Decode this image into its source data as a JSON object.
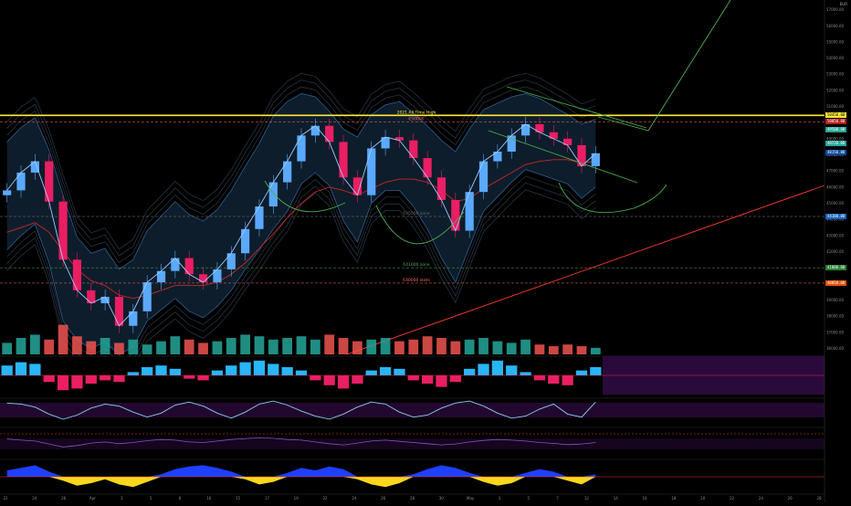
{
  "chart_data": {
    "type": "line",
    "title": "",
    "xlabel": "",
    "ylabel": "",
    "x_ticks": [
      "22",
      "24",
      "26",
      "Apr",
      "3",
      "5",
      "8",
      "10",
      "15",
      "17",
      "19",
      "22",
      "24",
      "26",
      "28",
      "30",
      "May",
      "3",
      "5",
      "7",
      "12",
      "14",
      "16",
      "18",
      "20",
      "22",
      "24",
      "26",
      "28"
    ],
    "y_ticks": [
      "57000.00",
      "56000.00",
      "55000.00",
      "54000.00",
      "53000.00",
      "52000.00",
      "51000.00",
      "50000.00",
      "49000.00",
      "48000.00",
      "47000.00",
      "46000.00",
      "45000.00",
      "44000.00",
      "43000.00",
      "42000.00",
      "41000.00",
      "40000.00",
      "39000.00",
      "38000.00",
      "37000.00",
      "36000.00"
    ],
    "ylim": [
      35800,
      57600
    ],
    "levels": [
      {
        "label": "2021 All Time High",
        "value": 50450,
        "color": "#ffeb3b"
      },
      {
        "label": "€50000",
        "value": 50050,
        "color": "#ff6b6b"
      },
      {
        "label": "€45000 zone",
        "value": 44180,
        "color": "#6a6a6a"
      },
      {
        "label": "€41000 zone",
        "value": 41000,
        "color": "#4caf50"
      },
      {
        "label": "€40000 stats",
        "value": 40050,
        "color": "#ff6b6b"
      }
    ],
    "price_labels": [
      {
        "text": "50450.00",
        "value": 50450,
        "bg": "#ffeb3b",
        "fg": "#000"
      },
      {
        "text": "50050.00",
        "value": 50050,
        "bg": "#b71c1c",
        "fg": "#fff"
      },
      {
        "text": "49500.00",
        "value": 49550,
        "bg": "#26a69a",
        "fg": "#fff"
      },
      {
        "text": "48720.00",
        "value": 48700,
        "bg": "#26a69a",
        "fg": "#fff"
      },
      {
        "text": "48150.00",
        "value": 48150,
        "bg": "#0d47a1",
        "fg": "#fff"
      },
      {
        "text": "44180.00",
        "value": 44180,
        "bg": "#1565c0",
        "fg": "#fff"
      },
      {
        "text": "41000.00",
        "value": 41000,
        "bg": "#2e7d32",
        "fg": "#fff"
      },
      {
        "text": "40050.00",
        "value": 40050,
        "bg": "#e65100",
        "fg": "#fff"
      }
    ],
    "series": [
      {
        "name": "",
        "color": "#5aa9ff",
        "values": [
          45800,
          46900,
          47600,
          45100,
          41500,
          39600,
          38800,
          39200,
          37400,
          38300,
          40100,
          40800,
          41600,
          40600,
          40100,
          40900,
          41900,
          43400,
          44800,
          46300,
          47600,
          49200,
          49800,
          48800,
          46600,
          45500,
          48400,
          49100,
          48900,
          47800,
          46600,
          45200,
          43300,
          45700,
          47600,
          48200,
          49200,
          49900,
          49400,
          49000,
          48600,
          47300,
          48100
        ]
      }
    ],
    "bb_upper": [
      48800,
      49700,
      50300,
      48300,
      45500,
      42900,
      41900,
      42200,
      40900,
      41500,
      43300,
      44200,
      45100,
      44300,
      43900,
      44600,
      45800,
      47300,
      48700,
      50400,
      51300,
      51800,
      51600,
      50700,
      49600,
      49100,
      50500,
      51100,
      51300,
      50600,
      49800,
      48900,
      48200,
      49600,
      50800,
      51200,
      51600,
      51800,
      51500,
      51000,
      50500,
      49900,
      50200
    ],
    "bb_lower": [
      42100,
      43000,
      43700,
      41300,
      37700,
      36500,
      36000,
      36400,
      35600,
      36100,
      37700,
      38400,
      39100,
      38300,
      37900,
      38600,
      39600,
      40900,
      42100,
      43400,
      44500,
      46200,
      46900,
      46100,
      43900,
      42600,
      45000,
      45800,
      45800,
      44800,
      43400,
      41600,
      40100,
      42300,
      44500,
      45400,
      46300,
      47100,
      46800,
      46500,
      46200,
      45300,
      46000
    ],
    "ema_red": [
      43200,
      43500,
      43800,
      43200,
      42000,
      40900,
      40200,
      39900,
      39300,
      39100,
      39300,
      39600,
      39900,
      39900,
      39900,
      40100,
      40600,
      41300,
      42200,
      43100,
      44100,
      45000,
      45700,
      46000,
      45800,
      45500,
      45900,
      46300,
      46500,
      46500,
      46300,
      45800,
      45100,
      45300,
      45900,
      46400,
      46900,
      47400,
      47600,
      47700,
      47700,
      47500,
      47600
    ],
    "volume": [
      0.35,
      0.5,
      0.6,
      0.45,
      0.9,
      0.55,
      0.4,
      0.5,
      0.35,
      0.45,
      0.3,
      0.4,
      0.55,
      0.45,
      0.35,
      0.4,
      0.5,
      0.6,
      0.55,
      0.45,
      0.5,
      0.55,
      0.45,
      0.6,
      0.5,
      0.4,
      0.45,
      0.5,
      0.4,
      0.45,
      0.55,
      0.5,
      0.4,
      0.45,
      0.5,
      0.4,
      0.35,
      0.45,
      0.3,
      0.25,
      0.3,
      0.25,
      0.2
    ],
    "macd_hist": [
      0.6,
      0.8,
      0.7,
      -0.4,
      -0.9,
      -0.8,
      -0.5,
      -0.3,
      -0.4,
      0.2,
      0.5,
      0.6,
      0.4,
      -0.2,
      -0.3,
      0.3,
      0.6,
      0.8,
      0.9,
      0.7,
      0.5,
      0.3,
      -0.3,
      -0.6,
      -0.8,
      -0.5,
      0.3,
      0.5,
      0.4,
      -0.3,
      -0.5,
      -0.7,
      -0.4,
      0.4,
      0.7,
      0.9,
      0.6,
      0.2,
      -0.3,
      -0.5,
      -0.6,
      0.3,
      0.5
    ],
    "oscillator": [
      0.7,
      0.6,
      0.3,
      -0.4,
      -0.9,
      -0.5,
      0.2,
      0.6,
      0.4,
      -0.2,
      -0.7,
      -0.3,
      0.5,
      0.8,
      0.4,
      -0.3,
      -0.8,
      -0.2,
      0.6,
      0.9,
      0.5,
      -0.1,
      -0.6,
      -0.9,
      -0.4,
      0.3,
      0.8,
      0.6,
      -0.2,
      -0.7,
      -0.5,
      0.2,
      0.7,
      0.9,
      0.4,
      -0.3,
      -0.8,
      -0.6,
      0.1,
      0.6,
      -0.4,
      -0.7,
      0.8
    ],
    "rsi": [
      0.62,
      0.58,
      0.55,
      0.45,
      0.35,
      0.4,
      0.48,
      0.52,
      0.46,
      0.5,
      0.56,
      0.6,
      0.58,
      0.52,
      0.5,
      0.55,
      0.6,
      0.63,
      0.66,
      0.64,
      0.6,
      0.58,
      0.52,
      0.46,
      0.42,
      0.48,
      0.55,
      0.58,
      0.54,
      0.5,
      0.46,
      0.42,
      0.45,
      0.52,
      0.57,
      0.6,
      0.58,
      0.55,
      0.5,
      0.47,
      0.43,
      0.45,
      0.5
    ],
    "wave": [
      0.5,
      0.7,
      0.9,
      0.4,
      -0.3,
      -0.7,
      -0.5,
      -0.2,
      -0.6,
      -0.8,
      -0.4,
      0.2,
      0.6,
      0.8,
      0.9,
      0.7,
      0.4,
      -0.2,
      -0.6,
      -0.4,
      0.3,
      0.7,
      0.5,
      0.8,
      0.6,
      -0.2,
      -0.6,
      -0.8,
      -0.5,
      0.2,
      0.6,
      0.9,
      0.7,
      0.3,
      -0.4,
      -0.7,
      -0.5,
      0.3,
      0.6,
      0.4,
      -0.3,
      -0.6,
      0.2
    ]
  },
  "header": {
    "symbol_short": "EUR",
    "price_top": "57000.00"
  },
  "colors": {
    "background": "#000000",
    "bull": "#26a69a",
    "bear": "#ef5350",
    "ath": "#ffeb3b",
    "trend_red": "#ff3b30",
    "trend_green": "#4caf50",
    "panel_purple": "#2a0a3a"
  }
}
